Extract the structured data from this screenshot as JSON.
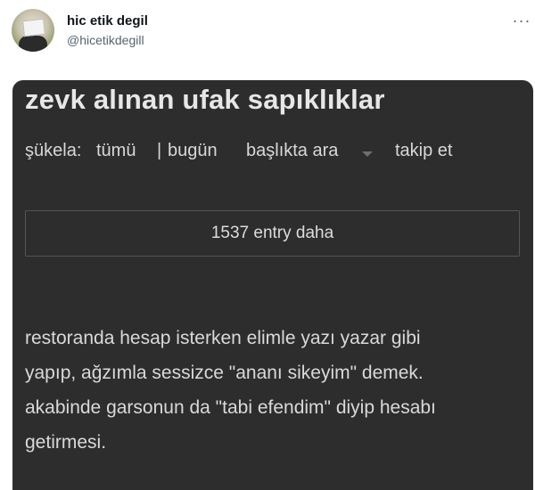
{
  "tweet": {
    "display_name": "hic etik degil",
    "handle": "@hicetikdegill",
    "more_glyph": "···"
  },
  "screenshot": {
    "title": "zevk alınan ufak sapıklıklar",
    "nav": {
      "sukela": "şükela:",
      "tumu": "tümü",
      "separator": "|",
      "bugun": "bugün",
      "search": "başlıkta ara",
      "follow": "takip et"
    },
    "more_entries": "1537 entry daha",
    "entry_lines": [
      "restoranda hesap isterken elimle yazı yazar gibi",
      "yapıp, ağzımla sessizce \"ananı sikeyim\" demek.",
      "akabinde garsonun da \"tabi efendim\" diyip hesabı",
      "getirmesi."
    ]
  }
}
